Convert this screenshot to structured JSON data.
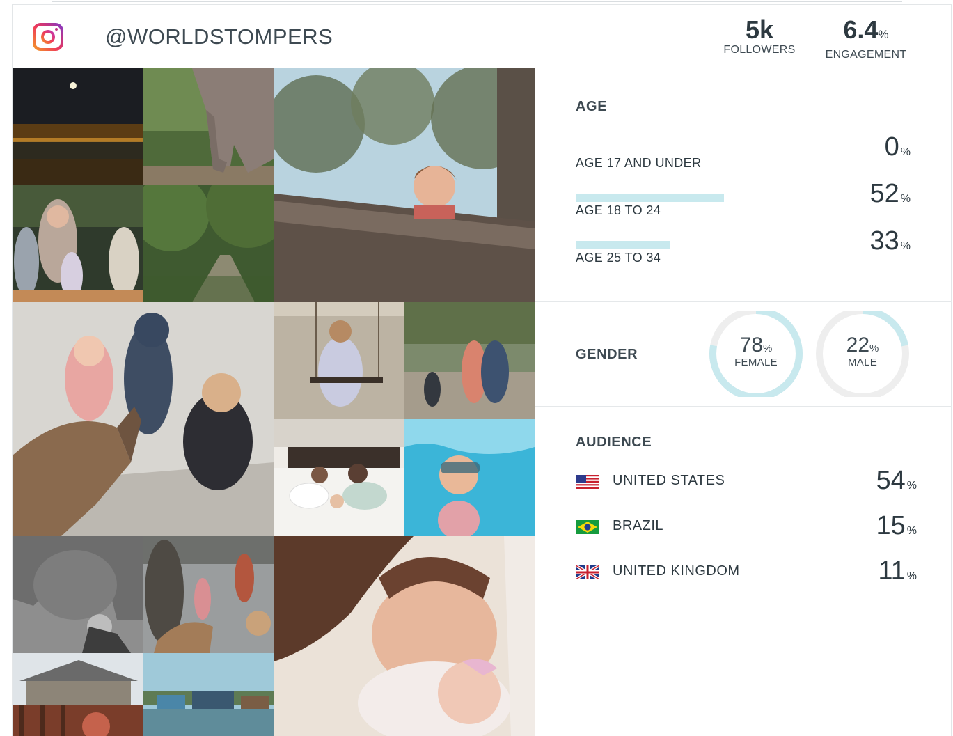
{
  "header": {
    "handle": "@WORLDSTOMPERS",
    "followers": {
      "value": "5k",
      "label": "FOLLOWERS"
    },
    "engagement": {
      "value": "6.4",
      "unit": "%",
      "label": "ENGAGEMENT"
    }
  },
  "icons": {
    "platform": "instagram-icon"
  },
  "age": {
    "title": "AGE",
    "unit": "%",
    "rows": [
      {
        "label": "AGE 17 AND UNDER",
        "value": "0",
        "fraction": 0.0
      },
      {
        "label": "AGE 18 TO 24",
        "value": "52",
        "fraction": 0.52
      },
      {
        "label": "AGE 25 TO 34",
        "value": "33",
        "fraction": 0.33
      }
    ]
  },
  "gender": {
    "title": "GENDER",
    "unit": "%",
    "female": {
      "value": "78",
      "label": "FEMALE",
      "fraction": 0.78
    },
    "male": {
      "value": "22",
      "label": "MALE",
      "fraction": 0.22
    },
    "ring_color": "#c8e9ee",
    "track_color": "#eeeeee"
  },
  "audience": {
    "title": "AUDIENCE",
    "unit": "%",
    "rows": [
      {
        "country": "UNITED STATES",
        "value": "54",
        "flag": "us-flag-icon"
      },
      {
        "country": "BRAZIL",
        "value": "15",
        "flag": "brazil-flag-icon"
      },
      {
        "country": "UNITED KINGDOM",
        "value": "11",
        "flag": "uk-flag-icon"
      }
    ]
  },
  "colors": {
    "bar": "#c8e9ee",
    "text": "#2d3940"
  }
}
